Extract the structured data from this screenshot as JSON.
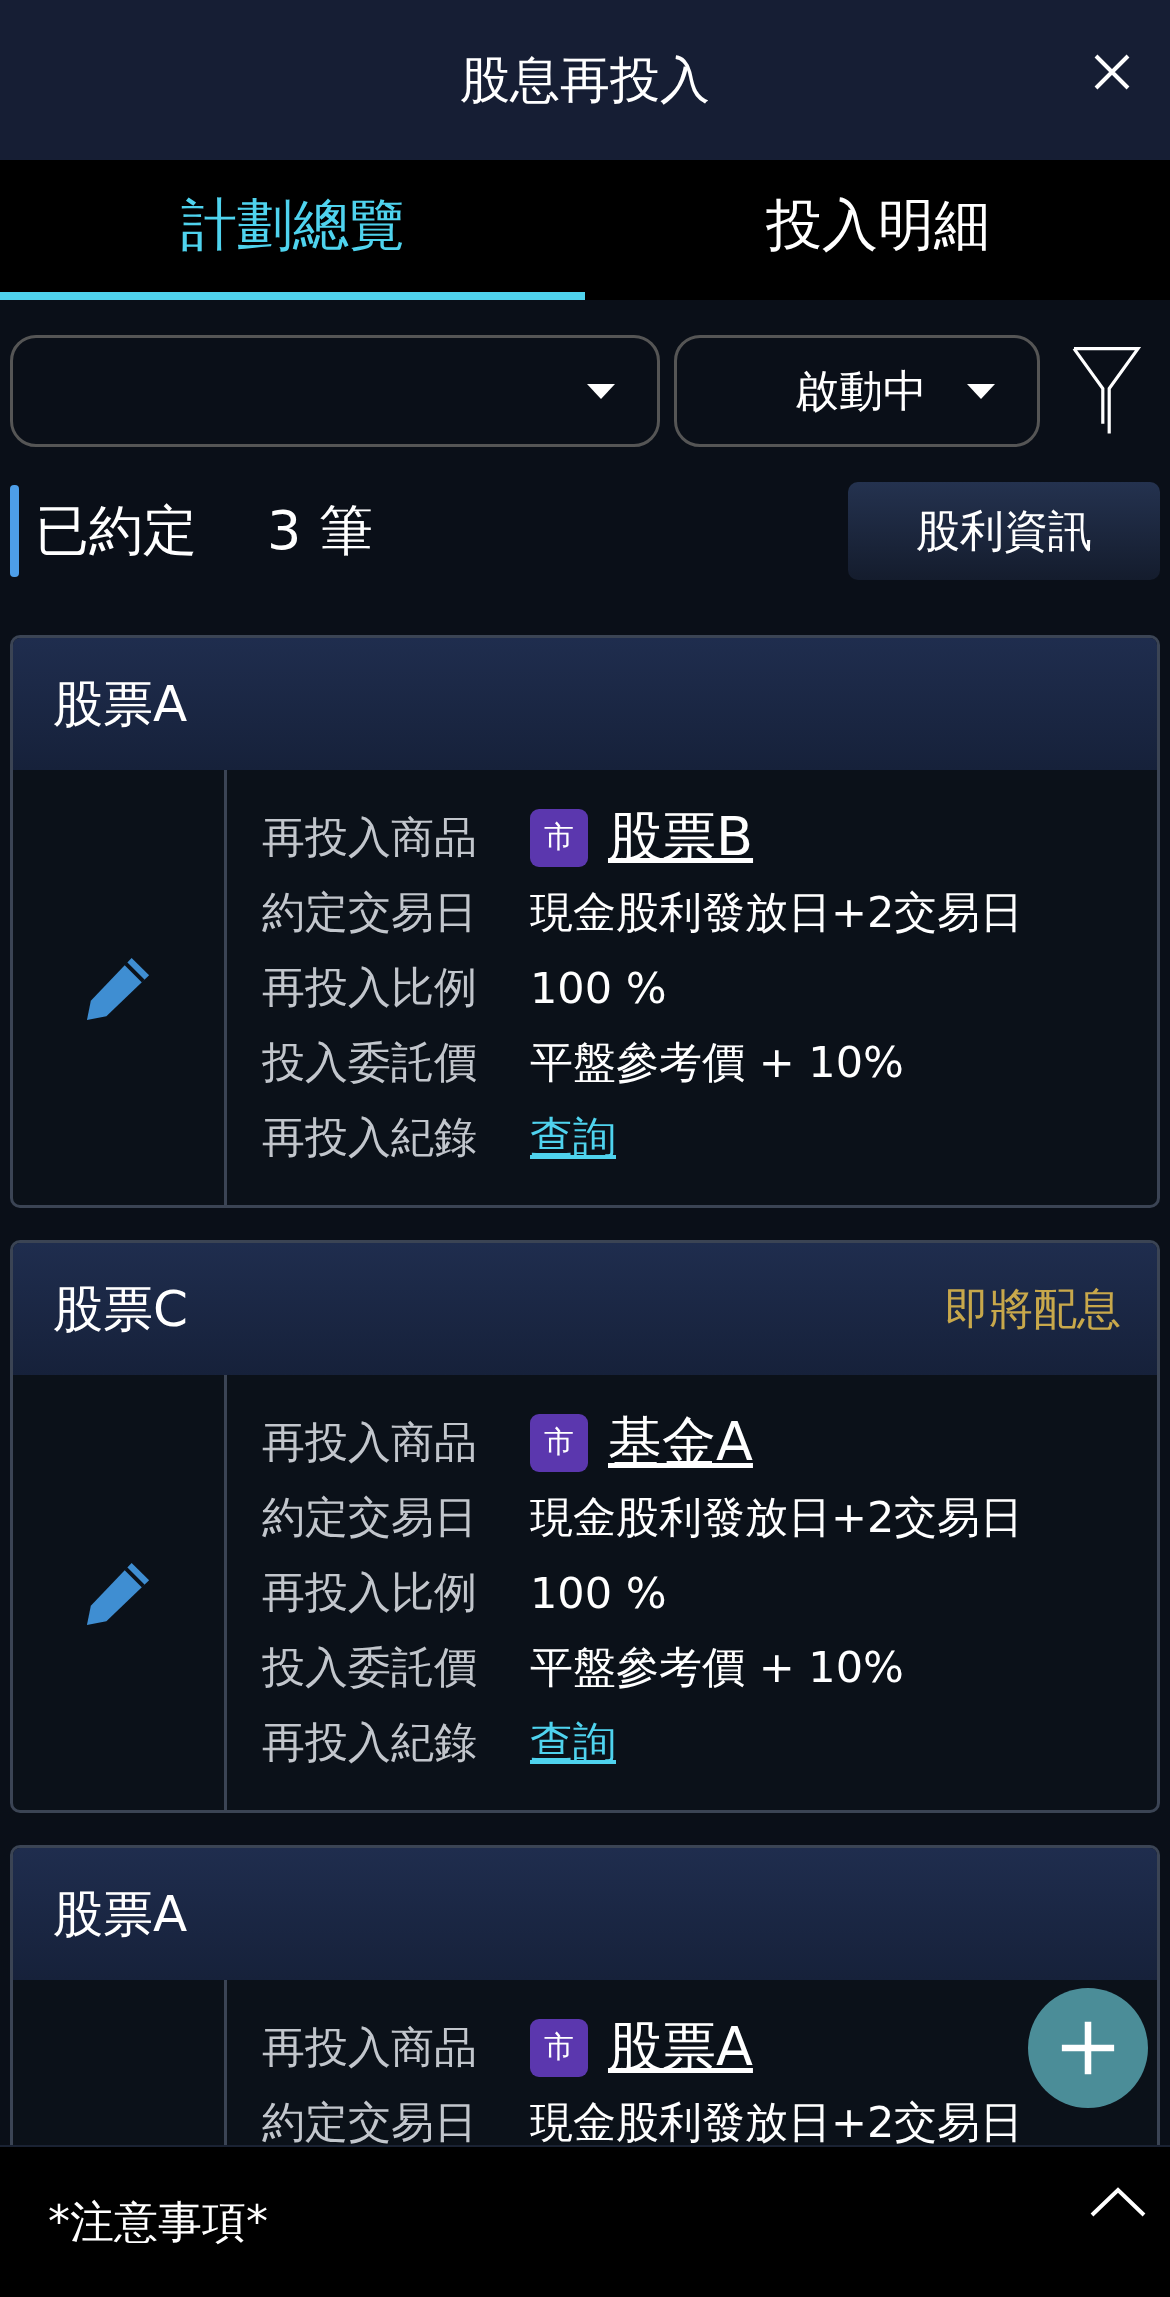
{
  "header": {
    "title": "股息再投入"
  },
  "tabs": [
    {
      "label": "計劃總覽",
      "selected": true
    },
    {
      "label": "投入明細",
      "selected": false
    }
  ],
  "filters": {
    "status_dropdown": "啟動中"
  },
  "summary": {
    "label": "已約定",
    "count": "3",
    "unit": "筆",
    "button": "股利資訊"
  },
  "plans": [
    {
      "title": "股票A",
      "edit": true,
      "rows": [
        {
          "kind": "product",
          "label": "再投入商品",
          "badge": "市",
          "value": "股票B"
        },
        {
          "kind": "text",
          "label": "約定交易日",
          "value": "現金股利發放日+2交易日"
        },
        {
          "kind": "text",
          "label": "再投入比例",
          "value": "100 %"
        },
        {
          "kind": "text",
          "label": "投入委託價",
          "value": "平盤參考價 + 10%"
        },
        {
          "kind": "link",
          "label": "再投入紀錄",
          "value": "查詢"
        }
      ]
    },
    {
      "title": "股票C",
      "status": "即將配息",
      "edit": true,
      "rows": [
        {
          "kind": "product",
          "label": "再投入商品",
          "badge": "市",
          "value": "基金A"
        },
        {
          "kind": "text",
          "label": "約定交易日",
          "value": "現金股利發放日+2交易日"
        },
        {
          "kind": "text",
          "label": "再投入比例",
          "value": "100 %"
        },
        {
          "kind": "text",
          "label": "投入委託價",
          "value": "平盤參考價 + 10%"
        },
        {
          "kind": "link",
          "label": "再投入紀錄",
          "value": "查詢"
        }
      ]
    },
    {
      "title": "股票A",
      "rows": [
        {
          "kind": "product",
          "label": "再投入商品",
          "badge": "市",
          "value": "股票A"
        },
        {
          "kind": "text",
          "label": "約定交易日",
          "value": "現金股利發放日+2交易日"
        }
      ]
    }
  ],
  "footer": {
    "notice": "*注意事項*"
  }
}
